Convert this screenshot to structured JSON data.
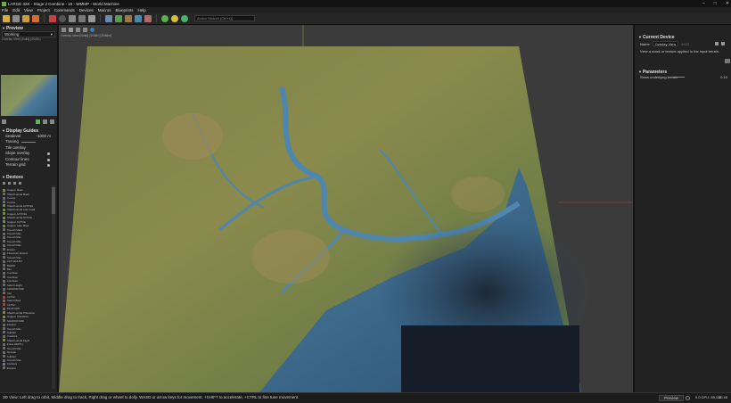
{
  "window": {
    "title": "LARGE 32K - Stage 2 Combine - 15 - WMMP - World Machine",
    "controls": [
      "–",
      "□",
      "✕"
    ]
  },
  "menu": [
    "File",
    "Edit",
    "View",
    "Project",
    "Commands",
    "Devices",
    "Macros",
    "Blueprints",
    "Help"
  ],
  "toolbar": {
    "search_placeholder": "Action Search (Ctrl+Q)"
  },
  "left": {
    "preview": {
      "title": "Preview",
      "dropdown": "Working",
      "caption": "Overlay View [Solid] (2048²)"
    },
    "display_guides": {
      "title": "Display Guides",
      "sealevel_label": "Sealevel",
      "sealevel_value": "-1000 m",
      "tracing_label": "Tracing",
      "tile_overlay": "Tile overlay",
      "slope_overlay": "Slope overlay",
      "contour_lines": "Contour lines",
      "terrain_grid": "Terrain grid"
    },
    "devices": {
      "title": "Devices",
      "items": [
        "Imagem Mask",
        "Shield Lamda Mask",
        "Inverter",
        "Inverter",
        "Shield Lamda ACTIVE2",
        "Shield Lamda Lake mask",
        "Imagem ACTIVE2",
        "Shield Lamda ACTIVE",
        "Imagem ACTIVE",
        "Imagem Lake Mask",
        "Smooth Mask",
        "Smooth Max",
        "Smooth Max",
        "Smooth Max",
        "Smooth Max",
        "Erosion",
        "Flowmeter Erosion",
        "Smooth Max",
        "ACT ADJUST",
        "BLEND",
        "Blur",
        "Combiner",
        "Combiner",
        "Combiner",
        "Select Height",
        "SHADOW MAP",
        "Clip",
        "ACT02",
        "Select Mask",
        "ACT02",
        "BLUR ADD",
        "Shield Lamda Tributaries",
        "Imagem Tributaries",
        "SHADOW MAP",
        "Expand",
        "Smooth Max",
        "Subtract",
        "Constant",
        "Shield Lamda Depth",
        "Erase DEPTH",
        "Smooth Max",
        "Rescale",
        "Subtract",
        "Smooth Max",
        "Constant",
        "Expand"
      ]
    }
  },
  "viewport": {
    "tab": "Overlay View [Solid] (2048²) [2048m]"
  },
  "right": {
    "current_device": {
      "title": "Current Device",
      "field_label": "Name",
      "field_value": "Overlay View",
      "field_id": "#113",
      "description": "View a mask or texture applied to the input terrain."
    },
    "parameters": {
      "title": "Parameters",
      "param_label": "Show underlying terrain",
      "param_value": "0.10"
    }
  },
  "status": {
    "help": "3D View: Left drag to orbit, Middle drag to track, Right drag or wheel to dolly. WASD or arrow keys for movement. +SHIFT to accelerate, +CTRL to fine tune movement.",
    "preview_button": "Preview",
    "cpu": "0.0 CPU: 85,116",
    "time": "20:48"
  }
}
